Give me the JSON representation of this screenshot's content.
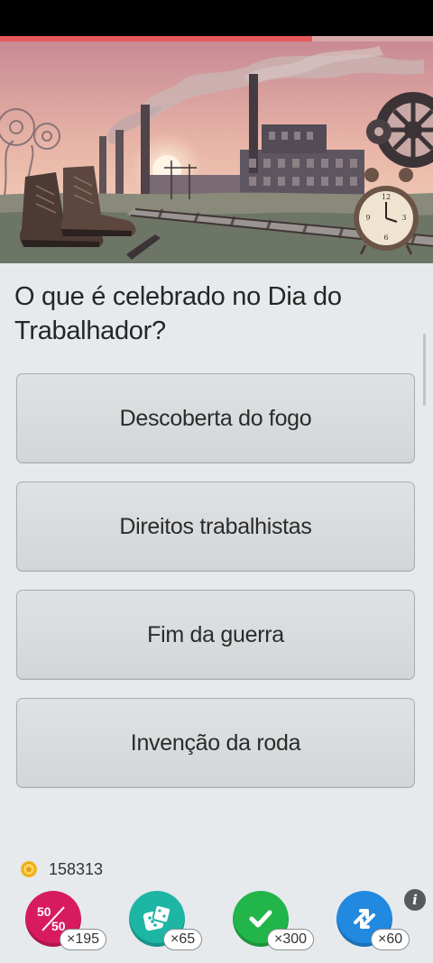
{
  "quiz": {
    "progress": 0.72,
    "question": "O que é celebrado no Dia do Trabalhador?",
    "answers": [
      {
        "label": "Descoberta do fogo"
      },
      {
        "label": "Direitos trabalhistas"
      },
      {
        "label": "Fim da guerra"
      },
      {
        "label": "Invenção da roda"
      }
    ]
  },
  "footer": {
    "coins": "158313",
    "info_label": "i",
    "powerups": [
      {
        "name": "fifty-fifty",
        "icon": "fifty-fifty-icon",
        "top": "50",
        "bottom": "50",
        "count": "×195",
        "color": "#d81b5f"
      },
      {
        "name": "dice",
        "icon": "dice-icon",
        "count": "×65",
        "color": "#1db5a4"
      },
      {
        "name": "correct-answer",
        "icon": "checkmark-icon",
        "count": "×300",
        "color": "#22b64a"
      },
      {
        "name": "skip",
        "icon": "swap-arrows-icon",
        "count": "×60",
        "color": "#2289e0"
      }
    ]
  }
}
